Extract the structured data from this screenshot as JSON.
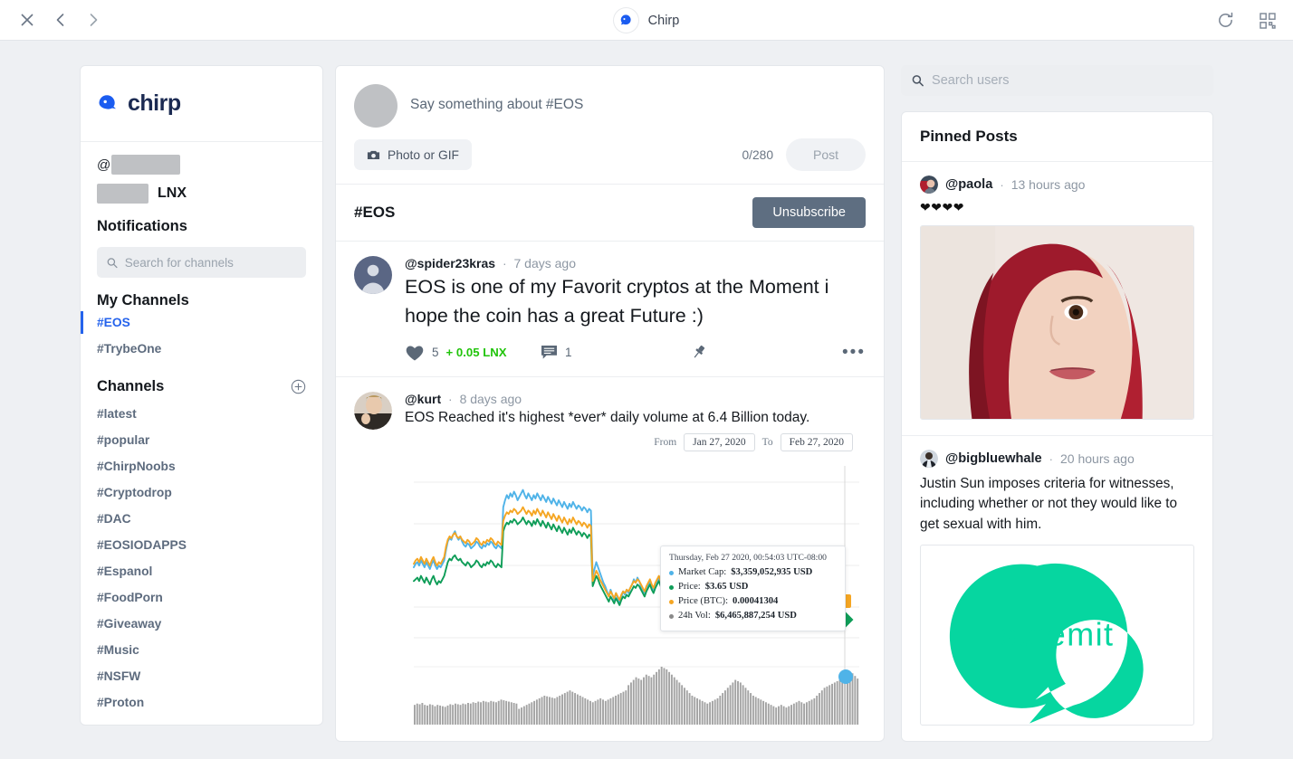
{
  "browser": {
    "title": "Chirp",
    "icons": {
      "close": "close-icon",
      "back": "back-icon",
      "forward": "forward-icon",
      "reload": "reload-icon",
      "qr": "qr-code-icon"
    }
  },
  "sidebar": {
    "logo_text": "chirp",
    "handle_prefix": "@",
    "balance_currency": "LNX",
    "notifications_label": "Notifications",
    "search": {
      "placeholder": "Search for channels",
      "value": ""
    },
    "my_channels_label": "My Channels",
    "my_channels": [
      {
        "label": "#EOS",
        "active": true
      },
      {
        "label": "#TrybeOne",
        "active": false
      }
    ],
    "channels_label": "Channels",
    "add_channel_icon": "plus-circle-icon",
    "channels": [
      {
        "label": "#latest"
      },
      {
        "label": "#popular"
      },
      {
        "label": "#ChirpNoobs"
      },
      {
        "label": "#Cryptodrop"
      },
      {
        "label": "#DAC"
      },
      {
        "label": "#EOSIODAPPS"
      },
      {
        "label": "#Espanol"
      },
      {
        "label": "#FoodPorn"
      },
      {
        "label": "#Giveaway"
      },
      {
        "label": "#Music"
      },
      {
        "label": "#NSFW"
      },
      {
        "label": "#Proton"
      }
    ]
  },
  "composer": {
    "placeholder": "Say something about #EOS",
    "photo_label": "Photo or GIF",
    "photo_icon": "camera-icon",
    "counter": "0/280",
    "post_label": "Post"
  },
  "channel_header": {
    "title": "#EOS",
    "unsubscribe_label": "Unsubscribe"
  },
  "posts": [
    {
      "user": "@spider23kras",
      "time": "7 days ago",
      "text": "EOS is one of my Favorit cryptos at the Moment i hope the coin  has a great Future :)",
      "avatar": "default-avatar",
      "likes": "5",
      "like_reward": "+ 0.05 LNX",
      "comments": "1",
      "like_icon": "heart-icon",
      "comment_icon": "comment-icon",
      "pin_icon": "pin-icon",
      "more_icon": "more-options-icon"
    },
    {
      "user": "@kurt",
      "time": "8 days ago",
      "text": "EOS Reached it's highest *ever* daily volume at 6.4 Billion today.",
      "avatar": "photo-avatar"
    }
  ],
  "chart_data": {
    "type": "line",
    "title": "",
    "xlabel": "",
    "ylabel": "",
    "grid": true,
    "legend_position": "tooltip",
    "range_from_label": "From",
    "range_to_label": "To",
    "range_from": "Jan 27, 2020",
    "range_to": "Feb 27, 2020",
    "tooltip": {
      "date": "Thursday, Feb 27 2020, 00:54:03 UTC-08:00",
      "rows": [
        {
          "label": "Market Cap:",
          "value": "$3,359,052,935 USD",
          "color": "#4fb3e8"
        },
        {
          "label": "Price:",
          "value": "$3.65 USD",
          "color": "#0f9d58"
        },
        {
          "label": "Price (BTC):",
          "value": "0.00041304",
          "color": "#f5a623"
        },
        {
          "label": "24h Vol:",
          "value": "$6,465,887,254 USD",
          "color": "#8a8a8a"
        }
      ]
    },
    "series": [
      {
        "name": "Market Cap",
        "color": "#4fb3e8",
        "values": [
          41,
          43,
          44,
          42,
          45,
          43,
          41,
          44,
          42,
          40,
          43,
          45,
          42,
          40,
          42,
          41,
          43,
          45,
          51,
          56,
          58,
          57,
          60,
          62,
          59,
          57,
          59,
          56,
          54,
          53,
          55,
          54,
          52,
          53,
          54,
          56,
          55,
          53,
          52,
          54,
          53,
          55,
          54,
          56,
          55,
          53,
          52,
          54,
          53,
          52,
          76,
          80,
          83,
          81,
          84,
          82,
          85,
          83,
          80,
          82,
          84,
          86,
          83,
          81,
          84,
          82,
          80,
          83,
          81,
          84,
          82,
          80,
          83,
          81,
          79,
          82,
          80,
          78,
          81,
          79,
          77,
          80,
          78,
          76,
          79,
          77,
          75,
          78,
          76,
          79,
          77,
          75,
          77,
          76,
          74,
          76,
          75,
          73,
          75,
          74,
          36,
          40,
          44,
          41,
          38,
          35,
          32,
          30,
          27,
          24,
          28,
          25,
          22,
          26,
          23,
          20,
          24,
          27,
          25,
          28,
          26,
          29,
          31,
          34,
          32,
          35,
          33,
          30,
          28,
          26,
          29,
          31,
          33,
          30,
          28,
          31,
          33,
          35,
          32,
          30,
          33,
          31,
          29,
          27,
          30,
          28,
          26,
          29,
          31,
          28,
          null,
          null,
          null,
          null,
          null,
          null,
          null,
          null,
          null,
          null,
          null,
          null,
          null,
          null,
          null,
          null,
          null,
          null,
          null,
          null,
          null,
          null,
          null,
          null,
          null,
          null,
          null,
          null,
          null,
          null,
          null,
          null,
          null,
          null,
          null,
          null,
          null,
          null,
          null,
          null,
          null,
          null,
          null,
          null,
          null,
          null,
          null,
          null,
          null,
          null,
          null,
          null,
          null,
          null,
          null,
          null,
          null,
          null,
          null,
          null,
          null,
          null,
          null,
          null,
          null,
          null,
          null,
          null,
          null,
          null,
          null,
          null,
          null,
          null,
          null,
          null,
          null,
          null,
          null,
          null,
          null,
          null,
          null,
          null,
          null,
          null,
          null,
          null,
          null,
          null,
          null,
          null,
          null,
          null,
          null,
          null,
          null,
          null,
          null,
          null
        ]
      },
      {
        "name": "Price",
        "color": "#0f9d58",
        "values": [
          33,
          34,
          35,
          33,
          36,
          34,
          32,
          35,
          33,
          31,
          34,
          36,
          33,
          31,
          33,
          32,
          34,
          36,
          40,
          44,
          46,
          45,
          47,
          48,
          46,
          45,
          46,
          44,
          43,
          42,
          44,
          43,
          41,
          42,
          43,
          45,
          44,
          42,
          41,
          43,
          42,
          44,
          43,
          45,
          44,
          42,
          41,
          43,
          42,
          41,
          62,
          65,
          67,
          66,
          68,
          67,
          69,
          68,
          66,
          67,
          68,
          70,
          68,
          66,
          68,
          67,
          65,
          68,
          66,
          69,
          67,
          65,
          68,
          66,
          64,
          67,
          65,
          63,
          66,
          64,
          62,
          65,
          63,
          61,
          64,
          62,
          60,
          63,
          61,
          64,
          62,
          60,
          62,
          61,
          59,
          61,
          60,
          58,
          60,
          59,
          30,
          33,
          36,
          34,
          31,
          29,
          27,
          25,
          23,
          21,
          24,
          22,
          20,
          23,
          21,
          19,
          22,
          24,
          23,
          25,
          24,
          26,
          28,
          30,
          29,
          31,
          30,
          28,
          26,
          24,
          27,
          29,
          31,
          28,
          26,
          29,
          31,
          33,
          30,
          28,
          31,
          29,
          27,
          25,
          28,
          26,
          24,
          27,
          29,
          26,
          null,
          null,
          null,
          null,
          null,
          null,
          null,
          null,
          null,
          null,
          null,
          null,
          null,
          null,
          null,
          null,
          null,
          null,
          null,
          null,
          null,
          null,
          null,
          null,
          null,
          null,
          null,
          null,
          null,
          null,
          null,
          null,
          null,
          null,
          null,
          null,
          null,
          null,
          null,
          null,
          null,
          null,
          null,
          null,
          null,
          null,
          null,
          null,
          null,
          null,
          null,
          null,
          null,
          null,
          null,
          null,
          null,
          null,
          null,
          null,
          null,
          null,
          null,
          null,
          null,
          null,
          null,
          null,
          null,
          null,
          null,
          null,
          null,
          null,
          null,
          null,
          null,
          null,
          null,
          null,
          null,
          null,
          null,
          null,
          null,
          null,
          null,
          null,
          null,
          null,
          null,
          null,
          null,
          null,
          null,
          null,
          null,
          null,
          null,
          null
        ]
      },
      {
        "name": "Price (BTC)",
        "color": "#f5a623",
        "values": [
          43,
          45,
          46,
          44,
          47,
          45,
          43,
          46,
          44,
          42,
          45,
          47,
          44,
          42,
          44,
          43,
          45,
          47,
          53,
          57,
          59,
          58,
          60,
          61,
          59,
          58,
          59,
          57,
          56,
          55,
          57,
          56,
          54,
          55,
          56,
          58,
          57,
          55,
          54,
          56,
          55,
          57,
          56,
          58,
          57,
          55,
          54,
          56,
          55,
          54,
          68,
          71,
          73,
          72,
          74,
          73,
          75,
          74,
          72,
          73,
          74,
          76,
          74,
          72,
          74,
          73,
          71,
          74,
          72,
          75,
          73,
          71,
          74,
          72,
          70,
          73,
          71,
          69,
          72,
          70,
          68,
          71,
          69,
          67,
          70,
          68,
          66,
          69,
          67,
          70,
          68,
          66,
          68,
          67,
          65,
          67,
          66,
          64,
          66,
          65,
          33,
          36,
          39,
          37,
          34,
          32,
          30,
          28,
          26,
          24,
          27,
          25,
          23,
          26,
          24,
          22,
          25,
          27,
          26,
          28,
          27,
          29,
          31,
          33,
          32,
          34,
          33,
          31,
          29,
          27,
          30,
          32,
          34,
          31,
          29,
          32,
          34,
          36,
          33,
          31,
          34,
          32,
          30,
          28,
          31,
          29,
          27,
          30,
          32,
          29,
          null,
          null,
          null,
          null,
          null,
          null,
          null,
          null,
          null,
          null,
          null,
          null,
          null,
          null,
          null,
          null,
          null,
          null,
          null,
          null,
          null,
          null,
          null,
          null,
          null,
          null,
          null,
          null,
          null,
          null,
          null,
          null,
          null,
          null,
          null,
          null,
          null,
          null,
          null,
          null,
          null,
          null,
          null,
          null,
          null,
          null,
          null,
          null,
          null,
          null,
          null,
          null,
          null,
          null,
          null,
          null,
          null,
          null,
          null,
          null,
          null,
          null,
          null,
          null,
          null,
          null,
          null,
          null,
          null,
          null,
          null,
          null,
          null,
          null,
          null,
          null,
          null,
          null,
          null,
          null,
          null,
          null,
          null,
          null,
          null,
          null,
          null,
          null,
          null,
          null,
          null,
          null,
          null,
          null,
          null,
          null,
          null,
          null,
          null,
          null
        ]
      }
    ],
    "volume": {
      "name": "24h Vol",
      "color": "#808080",
      "values": [
        30,
        32,
        31,
        33,
        30,
        29,
        31,
        30,
        28,
        30,
        29,
        28,
        27,
        29,
        31,
        30,
        32,
        31,
        30,
        32,
        31,
        33,
        32,
        34,
        33,
        35,
        34,
        36,
        35,
        34,
        36,
        35,
        34,
        36,
        38,
        37,
        36,
        35,
        34,
        33,
        32,
        24,
        26,
        28,
        30,
        32,
        34,
        36,
        38,
        40,
        42,
        44,
        43,
        42,
        41,
        40,
        42,
        44,
        46,
        48,
        50,
        52,
        50,
        48,
        46,
        44,
        42,
        40,
        38,
        36,
        34,
        36,
        38,
        40,
        38,
        36,
        38,
        40,
        42,
        44,
        46,
        48,
        50,
        52,
        60,
        64,
        68,
        72,
        70,
        68,
        72,
        76,
        74,
        72,
        76,
        80,
        84,
        88,
        86,
        84,
        80,
        76,
        72,
        68,
        64,
        60,
        56,
        52,
        48,
        44,
        42,
        40,
        38,
        36,
        34,
        32,
        34,
        36,
        38,
        40,
        44,
        48,
        52,
        56,
        60,
        64,
        68,
        66,
        64,
        60,
        56,
        52,
        48,
        44,
        42,
        40,
        38,
        36,
        34,
        32,
        30,
        28,
        26,
        28,
        30,
        28,
        26,
        28,
        30,
        32,
        34,
        36,
        34,
        32,
        34,
        36,
        38,
        40,
        44,
        48,
        52,
        56,
        58,
        60,
        62,
        64,
        66,
        68,
        70,
        72,
        74,
        76,
        78,
        74,
        70
      ]
    }
  },
  "right_rail": {
    "user_search": {
      "placeholder": "Search users",
      "value": "",
      "icon": "search-icon"
    },
    "pinned_title": "Pinned Posts",
    "pinned_posts": [
      {
        "user": "@paola",
        "time": "13 hours ago",
        "text": "❤❤❤❤",
        "has_image": true,
        "image_kind": "portrait-photo"
      },
      {
        "user": "@bigbluewhale",
        "time": "20 hours ago",
        "text": "Justin Sun imposes criteria for witnesses, including whether or not they would like to get sexual with him.",
        "has_image": true,
        "image_kind": "steemit-logo"
      }
    ]
  },
  "colors": {
    "accent_blue": "#2563ec",
    "logo_navy": "#1b2a52",
    "unsubscribe_bg": "#5e6e81",
    "lnx_green": "#21c40b",
    "steemit_teal": "#06d6a0",
    "page_bg": "#eef0f3"
  }
}
